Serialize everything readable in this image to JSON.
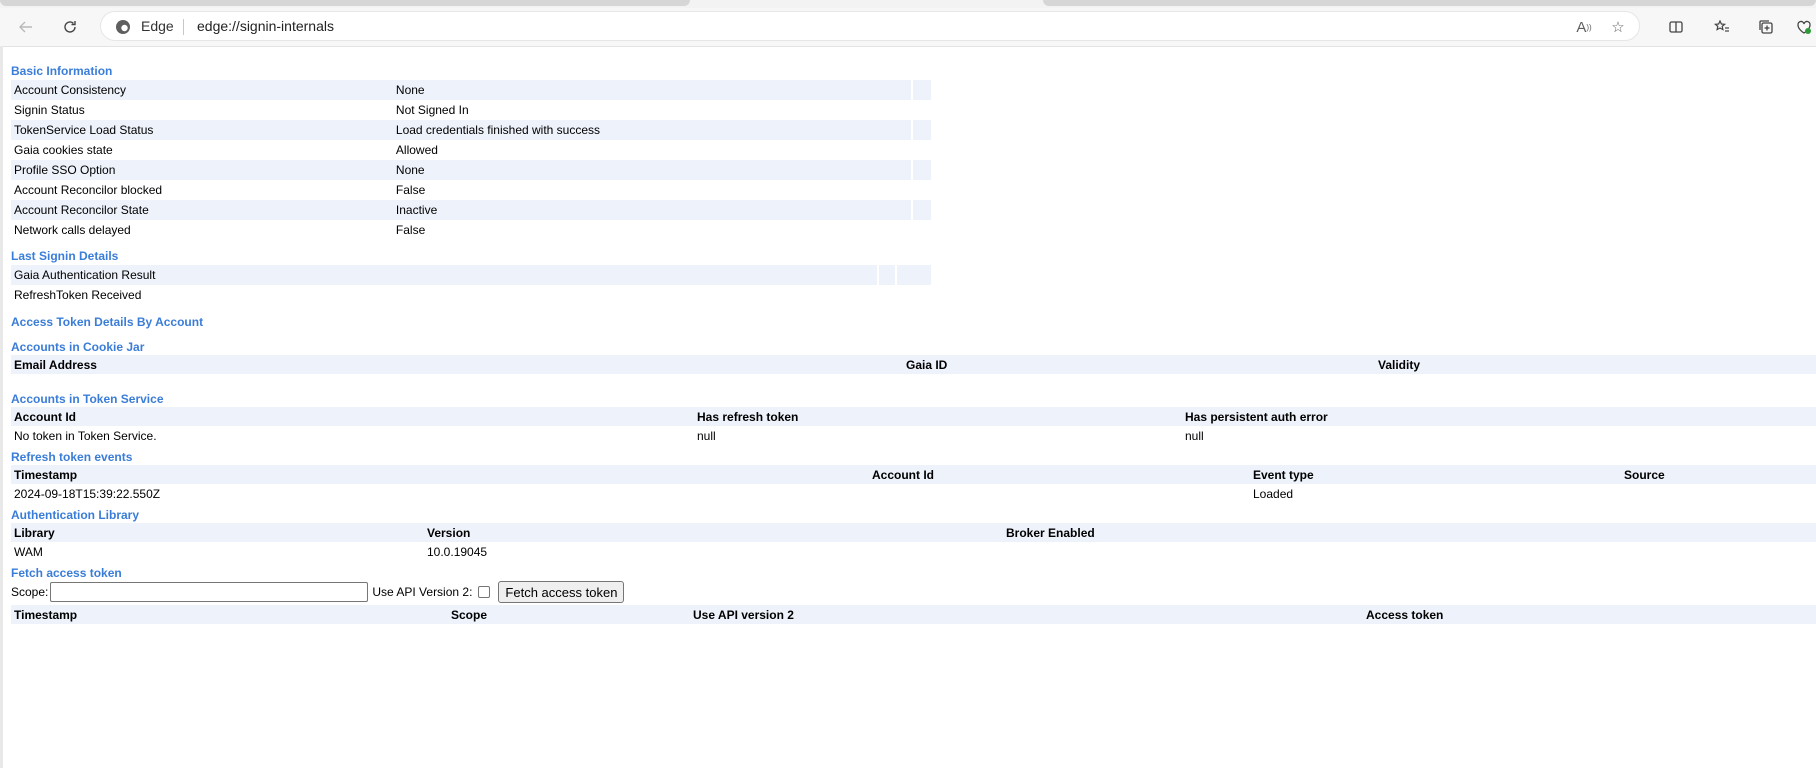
{
  "browser": {
    "site_name": "Edge",
    "url": "edge://signin-internals"
  },
  "sections": {
    "basic_info": {
      "title": "Basic Information",
      "rows": [
        {
          "label": "Account Consistency",
          "value": "None"
        },
        {
          "label": "Signin Status",
          "value": "Not Signed In"
        },
        {
          "label": "TokenService Load Status",
          "value": "Load credentials finished with success"
        },
        {
          "label": "Gaia cookies state",
          "value": "Allowed"
        },
        {
          "label": "Profile SSO Option",
          "value": "None"
        },
        {
          "label": "Account Reconcilor blocked",
          "value": "False"
        },
        {
          "label": "Account Reconcilor State",
          "value": "Inactive"
        },
        {
          "label": "Network calls delayed",
          "value": "False"
        }
      ]
    },
    "last_signin": {
      "title": "Last Signin Details",
      "rows": [
        {
          "label": "Gaia Authentication Result"
        },
        {
          "label": "RefreshToken Received"
        }
      ]
    },
    "access_token_details": {
      "title": "Access Token Details By Account"
    },
    "cookie_jar": {
      "title": "Accounts in Cookie Jar",
      "headers": [
        "Email Address",
        "Gaia ID",
        "Validity"
      ]
    },
    "token_service": {
      "title": "Accounts in Token Service",
      "headers": [
        "Account Id",
        "Has refresh token",
        "Has persistent auth error"
      ],
      "rows": [
        [
          "No token in Token Service.",
          "null",
          "null"
        ]
      ]
    },
    "refresh_events": {
      "title": "Refresh token events",
      "headers": [
        "Timestamp",
        "Account Id",
        "Event type",
        "Source"
      ],
      "rows": [
        [
          "2024-09-18T15:39:22.550Z",
          "",
          "Loaded",
          ""
        ]
      ]
    },
    "auth_library": {
      "title": "Authentication Library",
      "headers": [
        "Library",
        "Version",
        "Broker Enabled"
      ],
      "rows": [
        [
          "WAM",
          "10.0.19045",
          ""
        ]
      ]
    },
    "fetch_token": {
      "title": "Fetch access token",
      "scope_label": "Scope:",
      "scope_value": "",
      "api_label": "Use API Version 2:",
      "api_checked": false,
      "button_label": "Fetch access token",
      "headers": [
        "Timestamp",
        "Scope",
        "Use API version 2",
        "Access token"
      ]
    }
  }
}
